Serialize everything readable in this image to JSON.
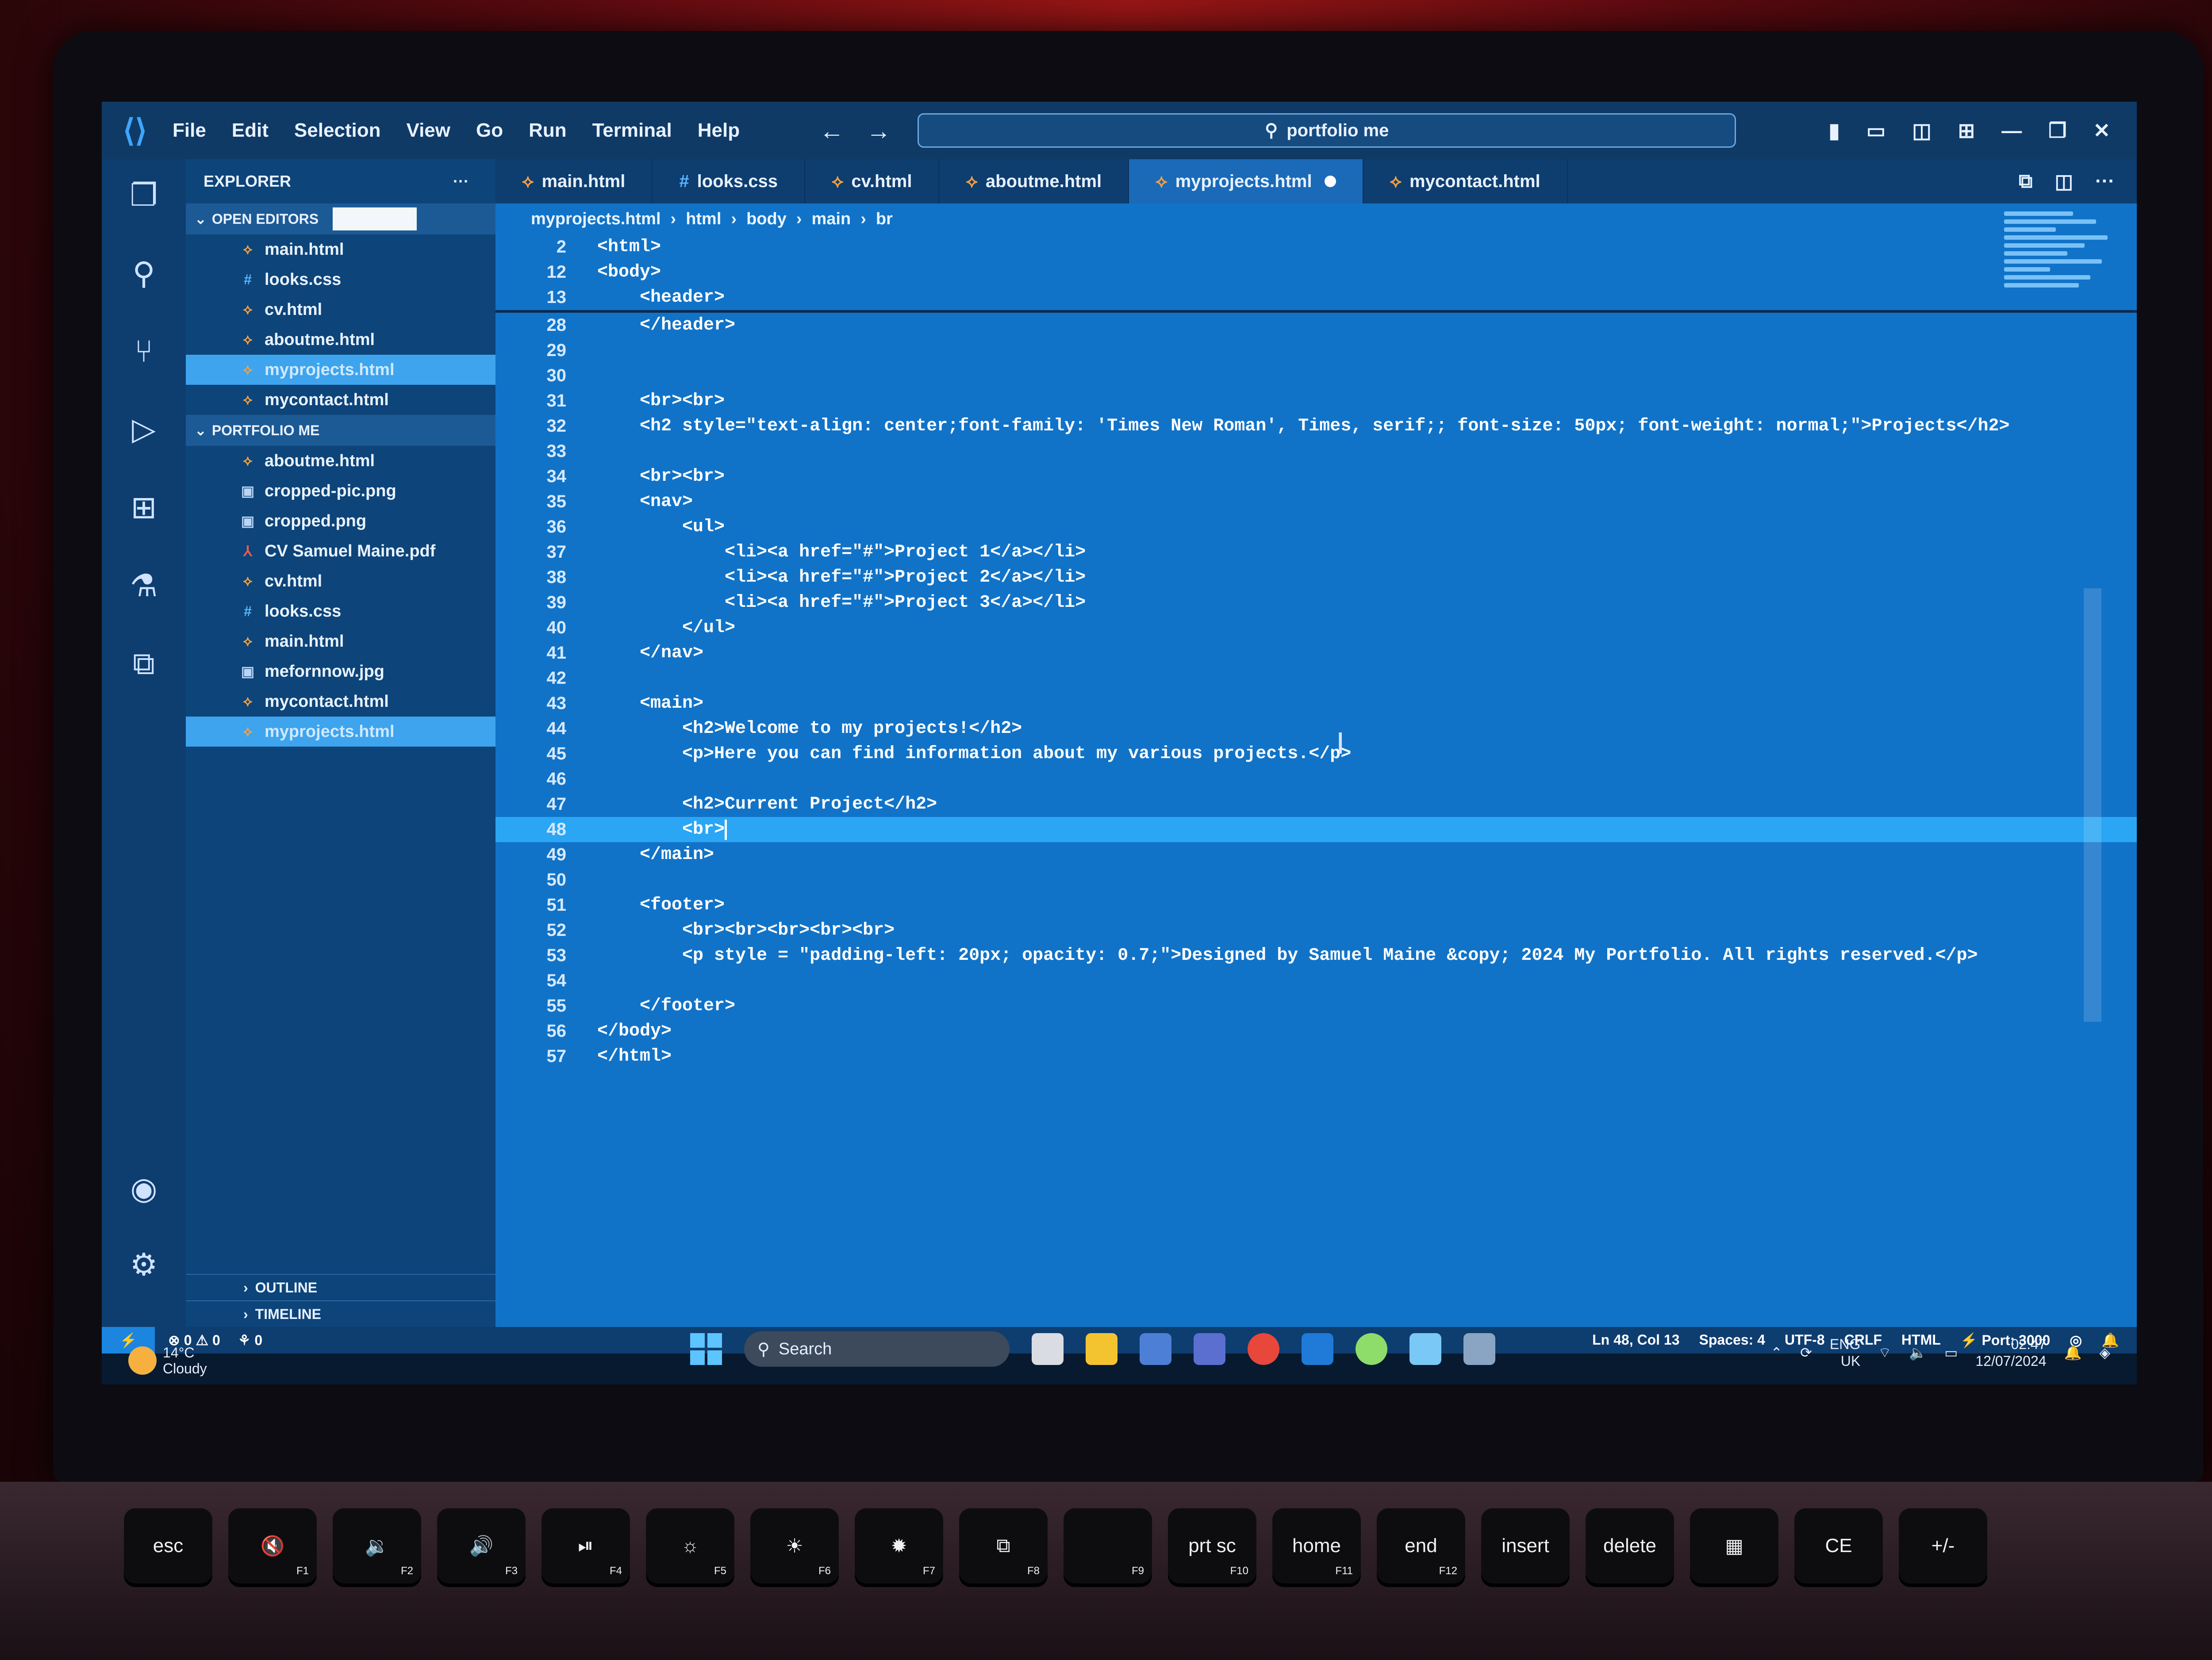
{
  "titlebar": {
    "menu": [
      "File",
      "Edit",
      "Selection",
      "View",
      "Go",
      "Run",
      "Terminal",
      "Help"
    ],
    "search_text": "portfolio me"
  },
  "sidebar": {
    "title": "EXPLORER",
    "more": "···",
    "open_editors_label": "OPEN EDITORS",
    "open_editors": [
      {
        "name": "main.html",
        "type": "html"
      },
      {
        "name": "looks.css",
        "type": "css"
      },
      {
        "name": "cv.html",
        "type": "html"
      },
      {
        "name": "aboutme.html",
        "type": "html"
      },
      {
        "name": "myprojects.html",
        "type": "html",
        "active": true
      },
      {
        "name": "mycontact.html",
        "type": "html"
      }
    ],
    "folder_label": "PORTFOLIO ME",
    "files": [
      {
        "name": "aboutme.html",
        "type": "html"
      },
      {
        "name": "cropped-pic.png",
        "type": "img"
      },
      {
        "name": "cropped.png",
        "type": "img"
      },
      {
        "name": "CV Samuel Maine.pdf",
        "type": "pdf"
      },
      {
        "name": "cv.html",
        "type": "html"
      },
      {
        "name": "looks.css",
        "type": "css"
      },
      {
        "name": "main.html",
        "type": "html"
      },
      {
        "name": "mefornnow.jpg",
        "type": "img"
      },
      {
        "name": "mycontact.html",
        "type": "html"
      },
      {
        "name": "myprojects.html",
        "type": "html",
        "active": true
      }
    ],
    "outline_label": "OUTLINE",
    "timeline_label": "TIMELINE"
  },
  "tabs": [
    {
      "label": "main.html",
      "type": "html"
    },
    {
      "label": "looks.css",
      "type": "css"
    },
    {
      "label": "cv.html",
      "type": "html"
    },
    {
      "label": "aboutme.html",
      "type": "html"
    },
    {
      "label": "myprojects.html",
      "type": "html",
      "active": true,
      "dirty": true
    },
    {
      "label": "mycontact.html",
      "type": "html"
    }
  ],
  "breadcrumb": [
    "myprojects.html",
    "html",
    "body",
    "main",
    "br"
  ],
  "sticky_lines": [
    {
      "n": "2",
      "code": "<html>"
    },
    {
      "n": "12",
      "code": "<body>"
    },
    {
      "n": "13",
      "code": "    <header>"
    }
  ],
  "code_lines": [
    {
      "n": "28",
      "code": "    </header>"
    },
    {
      "n": "29",
      "code": ""
    },
    {
      "n": "30",
      "code": ""
    },
    {
      "n": "31",
      "code": "    <br><br>"
    },
    {
      "n": "32",
      "code": "    <h2 style=\"text-align: center;font-family: 'Times New Roman', Times, serif;; font-size: 50px; font-weight: normal;\">Projects</h2>"
    },
    {
      "n": "33",
      "code": ""
    },
    {
      "n": "34",
      "code": "    <br><br>"
    },
    {
      "n": "35",
      "code": "    <nav>"
    },
    {
      "n": "36",
      "code": "        <ul>"
    },
    {
      "n": "37",
      "code": "            <li><a href=\"#\">Project 1</a></li>"
    },
    {
      "n": "38",
      "code": "            <li><a href=\"#\">Project 2</a></li>"
    },
    {
      "n": "39",
      "code": "            <li><a href=\"#\">Project 3</a></li>"
    },
    {
      "n": "40",
      "code": "        </ul>"
    },
    {
      "n": "41",
      "code": "    </nav>"
    },
    {
      "n": "42",
      "code": ""
    },
    {
      "n": "43",
      "code": "    <main>"
    },
    {
      "n": "44",
      "code": "        <h2>Welcome to my projects!</h2>"
    },
    {
      "n": "45",
      "code": "        <p>Here you can find information about my various projects.</p>"
    },
    {
      "n": "46",
      "code": ""
    },
    {
      "n": "47",
      "code": "        <h2>Current Project</h2>"
    },
    {
      "n": "48",
      "code": "        <br>",
      "current": true
    },
    {
      "n": "49",
      "code": "    </main>"
    },
    {
      "n": "50",
      "code": ""
    },
    {
      "n": "51",
      "code": "    <footer>"
    },
    {
      "n": "52",
      "code": "        <br><br><br><br><br>"
    },
    {
      "n": "53",
      "code": "        <p style = \"padding-left: 20px; opacity: 0.7;\">Designed by Samuel Maine &copy; 2024 My Portfolio. All rights reserved.</p>"
    },
    {
      "n": "54",
      "code": ""
    },
    {
      "n": "55",
      "code": "    </footer>"
    },
    {
      "n": "56",
      "code": "</body>"
    },
    {
      "n": "57",
      "code": "</html>"
    }
  ],
  "statusbar": {
    "errors": "0",
    "warnings": "0",
    "ports": "0",
    "position": "Ln 48, Col 13",
    "spaces": "Spaces: 4",
    "encoding": "UTF-8",
    "eol": "CRLF",
    "language": "HTML",
    "port": "Port: 3000"
  },
  "taskbar": {
    "weather_temp": "14°C",
    "weather_desc": "Cloudy",
    "search_label": "Search",
    "lang_top": "ENG",
    "lang_bottom": "UK",
    "time": "02:47",
    "date": "12/07/2024"
  },
  "keyboard": [
    {
      "label": "esc",
      "fn": ""
    },
    {
      "label": "🔇",
      "fn": "F1"
    },
    {
      "label": "🔉",
      "fn": "F2"
    },
    {
      "label": "🔊",
      "fn": "F3"
    },
    {
      "label": "⏯",
      "fn": "F4"
    },
    {
      "label": "☼",
      "fn": "F5"
    },
    {
      "label": "☀",
      "fn": "F6"
    },
    {
      "label": "✹",
      "fn": "F7"
    },
    {
      "label": "⧉",
      "fn": "F8"
    },
    {
      "label": "",
      "fn": "F9"
    },
    {
      "label": "prt sc",
      "fn": "F10"
    },
    {
      "label": "home",
      "fn": "F11"
    },
    {
      "label": "end",
      "fn": "F12"
    },
    {
      "label": "insert",
      "fn": ""
    },
    {
      "label": "delete",
      "fn": ""
    },
    {
      "label": "▦",
      "fn": ""
    },
    {
      "label": "CE",
      "fn": ""
    },
    {
      "label": "+/-",
      "fn": ""
    }
  ]
}
